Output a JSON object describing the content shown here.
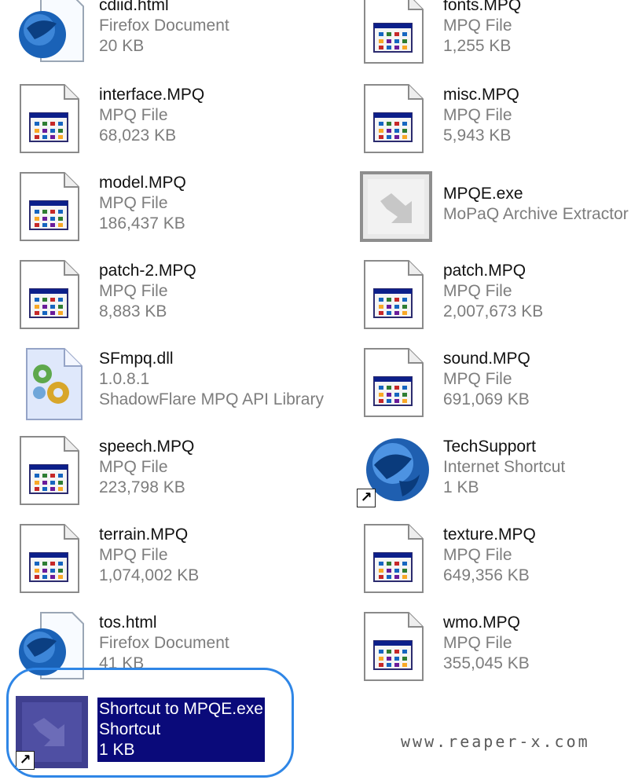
{
  "items": [
    {
      "name": "cdiid.html",
      "line2": "Firefox Document",
      "line3": "20 KB",
      "icon": "html-document-icon"
    },
    {
      "name": "fonts.MPQ",
      "line2": "MPQ File",
      "line3": "1,255 KB",
      "icon": "mpq-file-icon"
    },
    {
      "name": "interface.MPQ",
      "line2": "MPQ File",
      "line3": "68,023 KB",
      "icon": "mpq-file-icon"
    },
    {
      "name": "misc.MPQ",
      "line2": "MPQ File",
      "line3": "5,943 KB",
      "icon": "mpq-file-icon"
    },
    {
      "name": "model.MPQ",
      "line2": "MPQ File",
      "line3": "186,437 KB",
      "icon": "mpq-file-icon"
    },
    {
      "name": "MPQE.exe",
      "line2": "MoPaQ Archive Extractor",
      "line3": "",
      "icon": "exe-app-icon"
    },
    {
      "name": "patch-2.MPQ",
      "line2": "MPQ File",
      "line3": "8,883 KB",
      "icon": "mpq-file-icon"
    },
    {
      "name": "patch.MPQ",
      "line2": "MPQ File",
      "line3": "2,007,673 KB",
      "icon": "mpq-file-icon"
    },
    {
      "name": "SFmpq.dll",
      "line2": "1.0.8.1",
      "line3": "ShadowFlare MPQ API Library",
      "icon": "dll-gear-icon"
    },
    {
      "name": "sound.MPQ",
      "line2": "MPQ File",
      "line3": "691,069 KB",
      "icon": "mpq-file-icon"
    },
    {
      "name": "speech.MPQ",
      "line2": "MPQ File",
      "line3": "223,798 KB",
      "icon": "mpq-file-icon"
    },
    {
      "name": "TechSupport",
      "line2": "Internet Shortcut",
      "line3": "1 KB",
      "icon": "globe-shortcut-icon"
    },
    {
      "name": "terrain.MPQ",
      "line2": "MPQ File",
      "line3": "1,074,002 KB",
      "icon": "mpq-file-icon"
    },
    {
      "name": "texture.MPQ",
      "line2": "MPQ File",
      "line3": "649,356 KB",
      "icon": "mpq-file-icon"
    },
    {
      "name": "tos.html",
      "line2": "Firefox Document",
      "line3": "41 KB",
      "icon": "html-document-icon"
    },
    {
      "name": "wmo.MPQ",
      "line2": "MPQ File",
      "line3": "355,045 KB",
      "icon": "mpq-file-icon"
    },
    {
      "name": "Shortcut to MPQE.exe",
      "line2": "Shortcut",
      "line3": "1 KB",
      "icon": "exe-shortcut-icon",
      "selected": true
    }
  ],
  "watermark": "www.reaper-x.com",
  "colors": {
    "selection": "#0a0a7a",
    "highlight_ring": "#2f86e6",
    "meta_text": "#7d7d7d"
  }
}
